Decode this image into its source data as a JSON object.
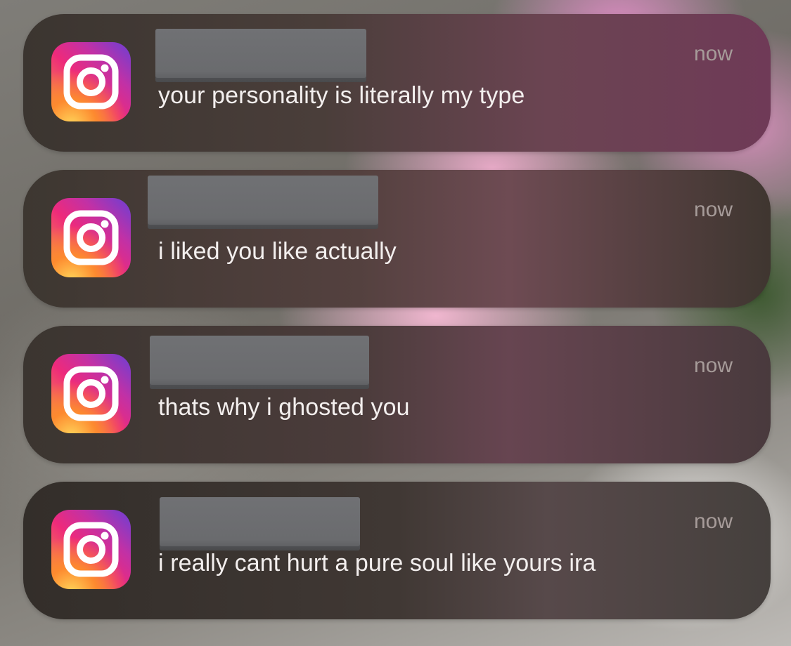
{
  "notifications": [
    {
      "app_icon": "instagram-icon",
      "message": "your personality is literally my type",
      "time": "now"
    },
    {
      "app_icon": "instagram-icon",
      "message": "i liked you like actually",
      "time": "now"
    },
    {
      "app_icon": "instagram-icon",
      "message": "thats why i ghosted you",
      "time": "now"
    },
    {
      "app_icon": "instagram-icon",
      "message": "i really cant hurt a pure soul like yours ira",
      "time": "now"
    }
  ]
}
